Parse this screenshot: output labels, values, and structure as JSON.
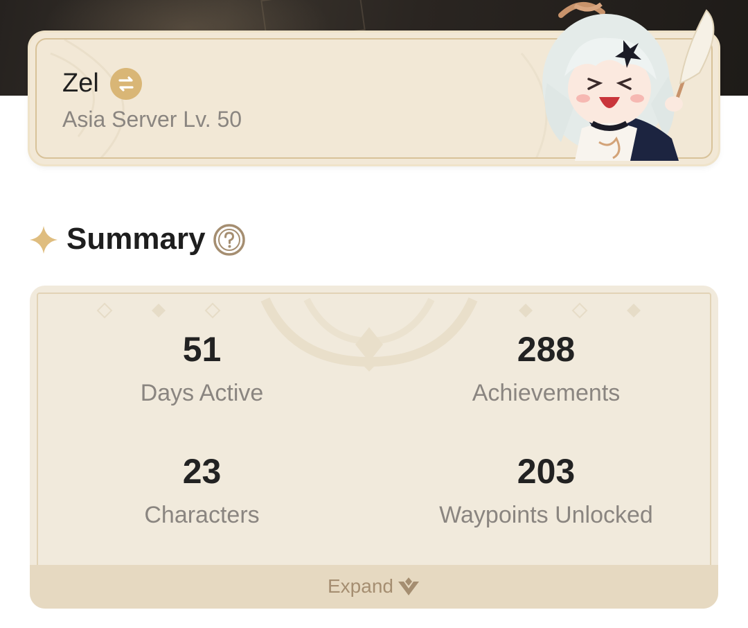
{
  "profile": {
    "name": "Zel",
    "server_level": "Asia Server Lv. 50",
    "swap_icon": "swap-arrows-icon",
    "mascot": "chibi-mascot-with-feather"
  },
  "summary": {
    "title": "Summary",
    "help_icon": "question-circle-icon",
    "stats": [
      {
        "value": "51",
        "label": "Days Active"
      },
      {
        "value": "288",
        "label": "Achievements"
      },
      {
        "value": "23",
        "label": "Characters"
      },
      {
        "value": "203",
        "label": "Waypoints Unlocked"
      }
    ],
    "expand_label": "Expand",
    "expand_icon": "chevron-down-diamond-icon"
  },
  "colors": {
    "card_bg": "#f2e8d6",
    "gold_accent": "#d9b676",
    "text_muted": "#8a8580",
    "expand_text": "#a58e71"
  }
}
